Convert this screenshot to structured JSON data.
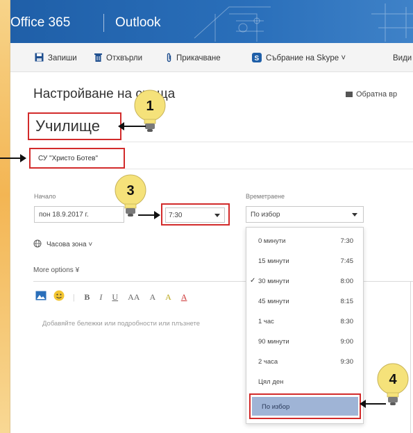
{
  "header": {
    "app_name": "Office 365",
    "module": "Outlook"
  },
  "toolbar": {
    "items": [
      {
        "label": "Запиши",
        "icon": "save-icon"
      },
      {
        "label": "Отхвърли",
        "icon": "trash-icon"
      },
      {
        "label": "Прикачване",
        "icon": "paperclip-icon"
      },
      {
        "label": "Събрание на Skype ˅",
        "icon": "skype-icon"
      },
      {
        "label": "Види",
        "icon": ""
      }
    ]
  },
  "form": {
    "title": "Настройване на  среща",
    "feedback": "Обратна вр",
    "subject_value": "Училище",
    "location_value": "СУ \"Христо Ботев\"",
    "start_label": "Начало",
    "start_date": "пон 18.9.2017 г.",
    "start_time": "7:30",
    "duration_label": "Времетраене",
    "duration_value": "По избор",
    "timezone": "Часова зона ˅",
    "more_options": "More options ¥",
    "editor_placeholder": "Добавяйте бележки или подробности или плъзнете"
  },
  "duration_menu": {
    "items": [
      {
        "label": "0 минути",
        "time": "7:30",
        "checked": false
      },
      {
        "label": "15 минути",
        "time": "7:45",
        "checked": false
      },
      {
        "label": "30 минути",
        "time": "8:00",
        "checked": true
      },
      {
        "label": "45 минути",
        "time": "8:15",
        "checked": false
      },
      {
        "label": "1 час",
        "time": "8:30",
        "checked": false
      },
      {
        "label": "90 минути",
        "time": "9:00",
        "checked": false
      },
      {
        "label": "2 часа",
        "time": "9:30",
        "checked": false
      },
      {
        "label": "Цял ден",
        "time": "",
        "checked": false
      },
      {
        "label": "По избор",
        "time": "",
        "checked": false
      }
    ],
    "check_mark": "✓"
  },
  "markers": [
    "1",
    "3",
    "4"
  ],
  "colors": {
    "header_blue": "#2a6fba",
    "highlight_red": "#d22a2a",
    "selected_bg": "#9fb4d6",
    "bulb_yellow": "#f5e27a"
  }
}
